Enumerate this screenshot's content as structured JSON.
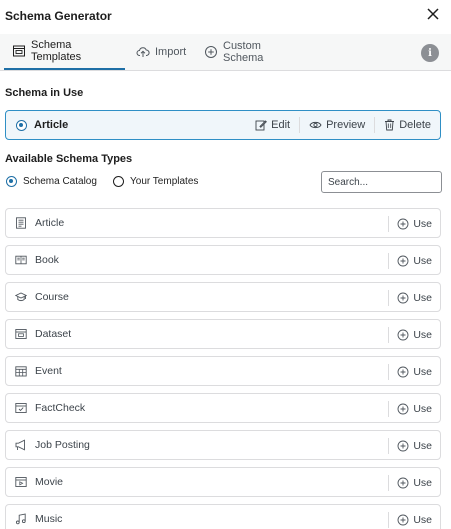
{
  "header": {
    "title": "Schema Generator",
    "close_icon": "close-icon"
  },
  "tabs": [
    {
      "label": "Schema Templates",
      "icon": "templates-icon",
      "active": true
    },
    {
      "label": "Import",
      "icon": "cloud-import-icon",
      "active": false
    },
    {
      "label": "Custom Schema",
      "icon": "plus-circle-icon",
      "active": false
    }
  ],
  "info_label": "i",
  "in_use": {
    "section_title": "Schema in Use",
    "name": "Article",
    "edit_label": "Edit",
    "preview_label": "Preview",
    "delete_label": "Delete"
  },
  "available": {
    "section_title": "Available Schema Types",
    "filter_catalog": "Schema Catalog",
    "filter_yours": "Your Templates",
    "selected_filter": "Schema Catalog",
    "search_placeholder": "Search...",
    "use_label": "Use",
    "items": [
      {
        "label": "Article",
        "icon": "article-icon"
      },
      {
        "label": "Book",
        "icon": "book-icon"
      },
      {
        "label": "Course",
        "icon": "graduation-cap-icon"
      },
      {
        "label": "Dataset",
        "icon": "dataset-icon"
      },
      {
        "label": "Event",
        "icon": "calendar-icon"
      },
      {
        "label": "FactCheck",
        "icon": "factcheck-icon"
      },
      {
        "label": "Job Posting",
        "icon": "megaphone-icon"
      },
      {
        "label": "Movie",
        "icon": "movie-icon"
      },
      {
        "label": "Music",
        "icon": "music-icon"
      }
    ]
  },
  "colors": {
    "accent": "#1e6fa6",
    "border": "#dcdcde",
    "in_use_bg": "#f0f6fa"
  }
}
